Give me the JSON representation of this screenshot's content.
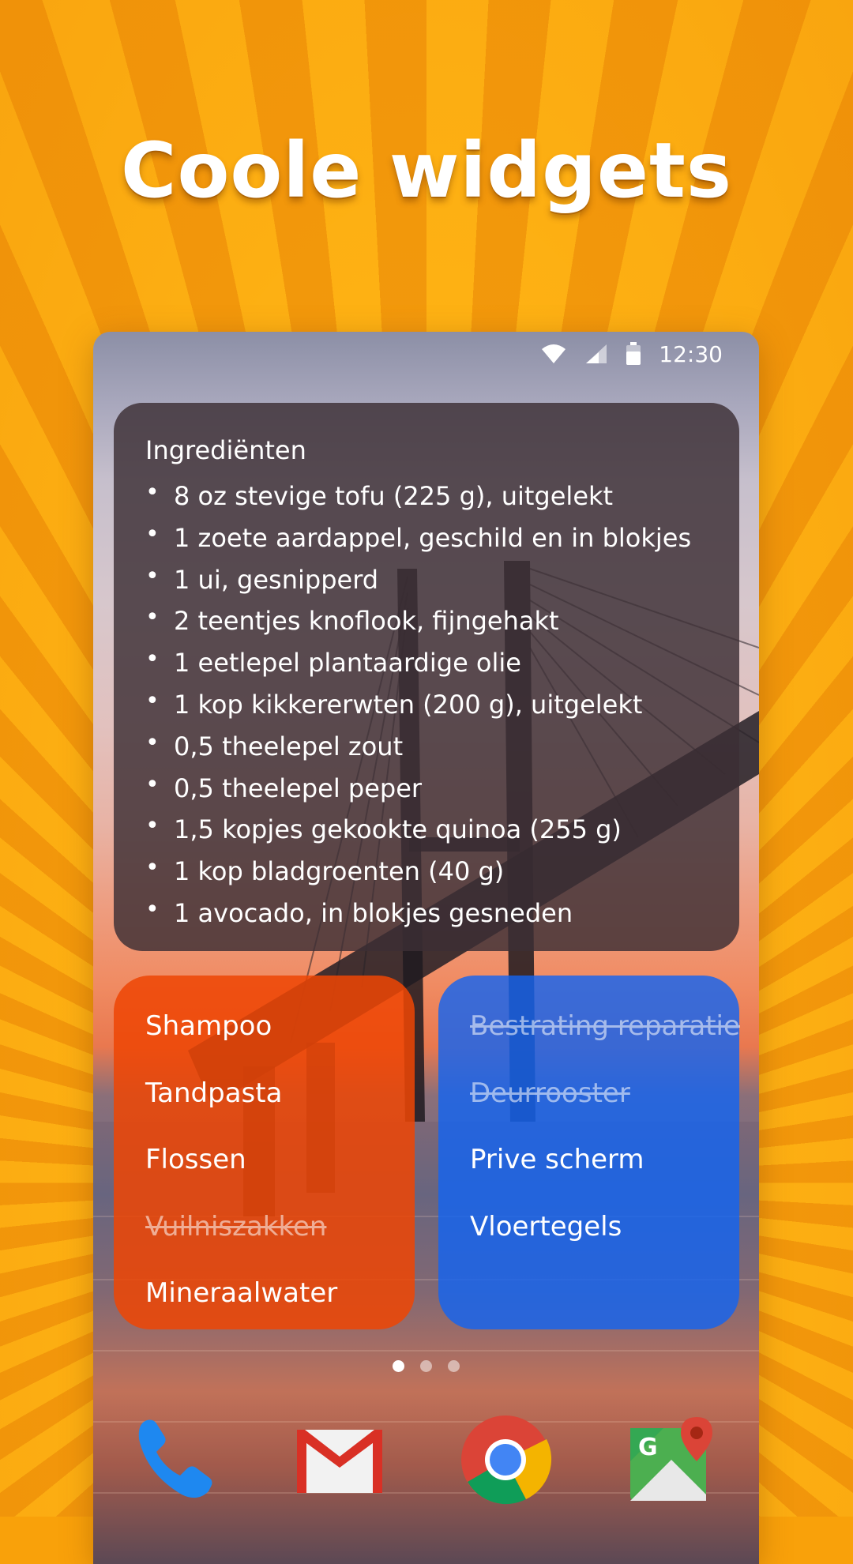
{
  "headline": "Coole widgets",
  "status_bar": {
    "time": "12:30",
    "icons": [
      "wifi-icon",
      "signal-icon",
      "battery-icon"
    ]
  },
  "ingredients_widget": {
    "title": "Ingrediënten",
    "items": [
      "8 oz stevige tofu (225 g), uitgelekt",
      "1 zoete aardappel, geschild en in blokjes",
      "1 ui, gesnipperd",
      "2 teentjes knoflook, fijngehakt",
      "1 eetlepel plantaardige olie",
      "1 kop kikkererwten (200 g), uitgelekt",
      "0,5 theelepel zout",
      "0,5 theelepel peper",
      "1,5 kopjes gekookte quinoa (255 g)",
      "1 kop bladgroenten (40 g)",
      "1 avocado, in blokjes gesneden"
    ]
  },
  "shopping_widget": {
    "color": "#ee4605",
    "items": [
      {
        "label": "Shampoo",
        "done": false
      },
      {
        "label": "Tandpasta",
        "done": false
      },
      {
        "label": "Flossen",
        "done": false
      },
      {
        "label": "Vuilniszakken",
        "done": true
      },
      {
        "label": "Mineraalwater",
        "done": false
      }
    ]
  },
  "todo_widget": {
    "color": "#1464f0",
    "items": [
      {
        "label": "Bestrating reparatie",
        "done": true
      },
      {
        "label": "Deurrooster",
        "done": true
      },
      {
        "label": "Prive scherm",
        "done": false
      },
      {
        "label": "Vloertegels",
        "done": false
      }
    ]
  },
  "page_indicator": {
    "pages": 3,
    "current": 1
  },
  "dock": [
    "phone-icon",
    "gmail-icon",
    "chrome-icon",
    "maps-icon"
  ],
  "colors": {
    "background": "#f9a10a",
    "accent_orange": "#ee4605",
    "accent_blue": "#1464f0"
  }
}
